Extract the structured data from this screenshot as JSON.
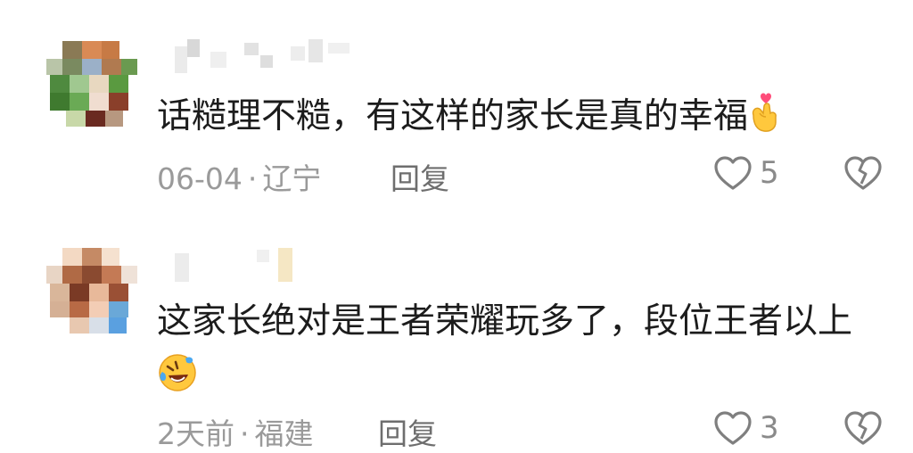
{
  "comments": [
    {
      "text": "话糙理不糙，有这样的家长是真的幸福",
      "emoji": "finger-heart-emoji",
      "date": "06-04",
      "location": "辽宁",
      "reply_label": "回复",
      "likes": "5"
    },
    {
      "text": "这家长绝对是王者荣耀玩多了，段位王者以上",
      "emoji": "rolling-laughing-emoji",
      "date": "2天前",
      "location": "福建",
      "reply_label": "回复",
      "likes": "3"
    }
  ],
  "icons": {
    "like": "heart-outline-icon",
    "dislike": "broken-heart-icon"
  },
  "colors": {
    "text": "#1c1c1c",
    "meta": "#9a9a9a",
    "icon": "#7f7f7f"
  }
}
